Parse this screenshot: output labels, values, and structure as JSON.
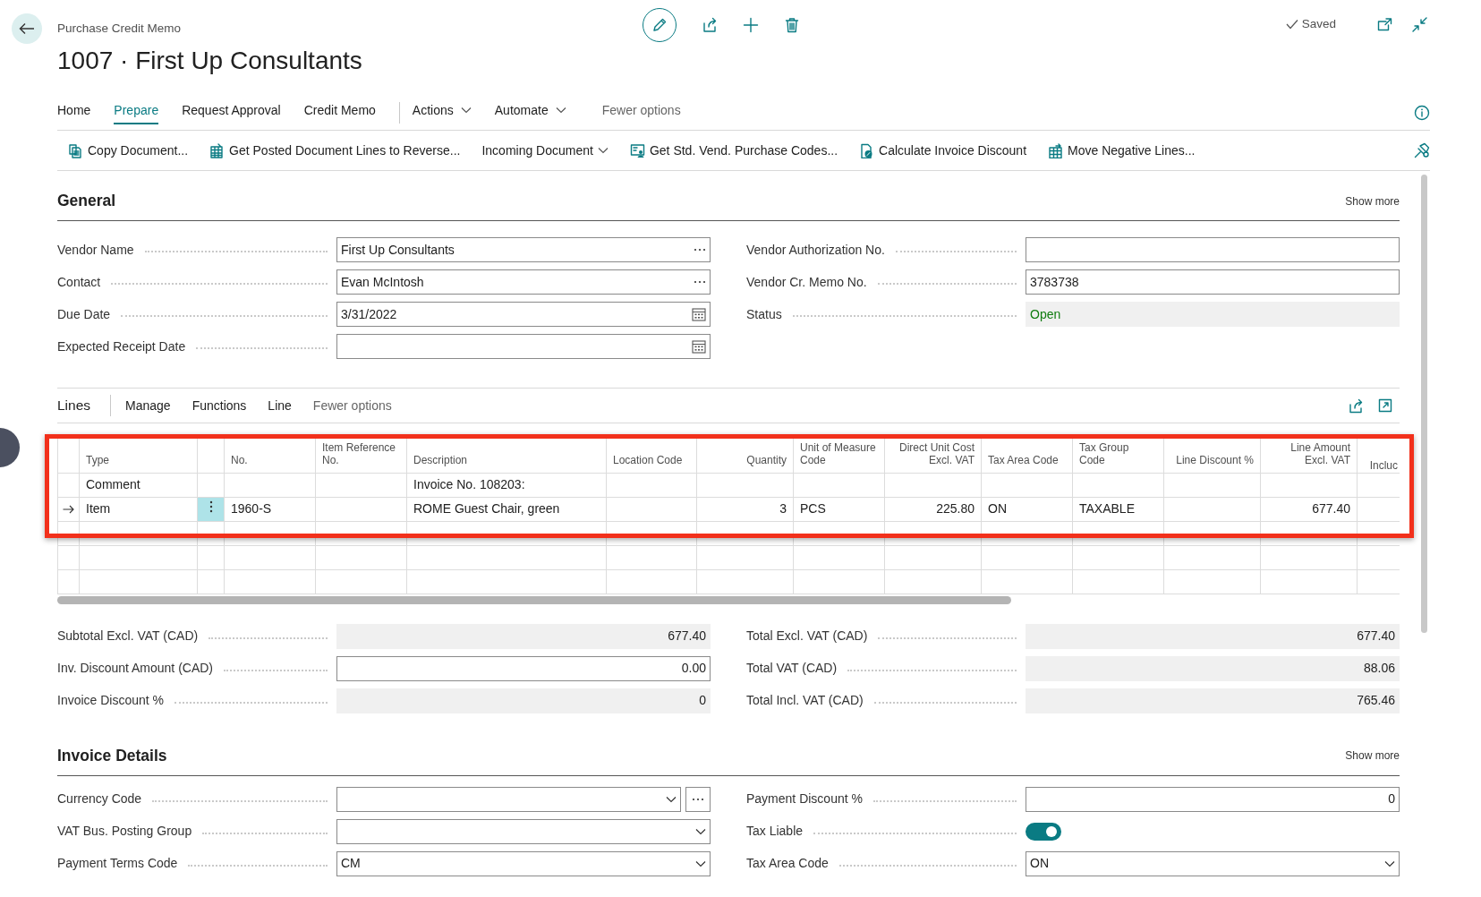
{
  "header": {
    "breadcrumb": "Purchase Credit Memo",
    "title": "1007 · First Up Consultants",
    "saved": "Saved"
  },
  "tabs": [
    {
      "label": "Home",
      "selected": false,
      "kind": "tab"
    },
    {
      "label": "Prepare",
      "selected": true,
      "kind": "tab"
    },
    {
      "label": "Request Approval",
      "selected": false,
      "kind": "tab"
    },
    {
      "label": "Credit Memo",
      "selected": false,
      "kind": "tab"
    },
    {
      "label": "Actions",
      "selected": false,
      "kind": "menu"
    },
    {
      "label": "Automate",
      "selected": false,
      "kind": "menu"
    },
    {
      "label": "Fewer options",
      "selected": false,
      "kind": "more"
    }
  ],
  "actions": [
    {
      "label": "Copy Document...",
      "dropdown": false
    },
    {
      "label": "Get Posted Document Lines to Reverse...",
      "dropdown": false
    },
    {
      "label": "Incoming Document",
      "dropdown": true
    },
    {
      "label": "Get Std. Vend. Purchase Codes...",
      "dropdown": false
    },
    {
      "label": "Calculate Invoice Discount",
      "dropdown": false
    },
    {
      "label": "Move Negative Lines...",
      "dropdown": false
    }
  ],
  "general": {
    "title": "General",
    "show_more": "Show more",
    "left": [
      {
        "label": "Vendor Name",
        "value": "First Up Consultants",
        "kind": "lookup"
      },
      {
        "label": "Contact",
        "value": "Evan McIntosh",
        "kind": "lookup"
      },
      {
        "label": "Due Date",
        "value": "3/31/2022",
        "kind": "date"
      },
      {
        "label": "Expected Receipt Date",
        "kind": "date"
      }
    ],
    "right": [
      {
        "label": "Vendor Authorization No.",
        "kind": "text"
      },
      {
        "label": "Vendor Cr. Memo No.",
        "value": "3783738",
        "kind": "text"
      },
      {
        "label": "Status",
        "value": "Open",
        "kind": "status"
      }
    ]
  },
  "lines": {
    "title": "Lines",
    "menu": [
      "Manage",
      "Functions",
      "Line",
      "Fewer options"
    ],
    "columns": [
      "Type",
      "No.",
      "Item Reference No.",
      "Description",
      "Location Code",
      "Quantity",
      "Unit of Measure Code",
      "Direct Unit Cost Excl. VAT",
      "Tax Area Code",
      "Tax Group Code",
      "Line Discount %",
      "Line Amount Excl. VAT",
      "Incluc"
    ],
    "rows": [
      {
        "selected": false,
        "cells": [
          "Comment",
          null,
          null,
          "Invoice No. 108203:",
          null,
          null,
          null,
          null,
          null,
          null,
          null,
          null,
          null
        ]
      },
      {
        "selected": true,
        "cells": [
          "Item",
          "1960-S",
          null,
          "ROME Guest Chair, green",
          null,
          "3",
          "PCS",
          "225.80",
          "ON",
          "TAXABLE",
          null,
          "677.40",
          null
        ]
      }
    ]
  },
  "totals": {
    "left": [
      {
        "label": "Subtotal Excl. VAT (CAD)",
        "value": "677.40",
        "kind": "readonly"
      },
      {
        "label": "Inv. Discount Amount (CAD)",
        "value": "0.00",
        "kind": "number"
      },
      {
        "label": "Invoice Discount %",
        "value": "0",
        "kind": "readonly"
      }
    ],
    "right": [
      {
        "label": "Total Excl. VAT (CAD)",
        "value": "677.40",
        "kind": "readonly"
      },
      {
        "label": "Total VAT (CAD)",
        "value": "88.06",
        "kind": "readonly"
      },
      {
        "label": "Total Incl. VAT (CAD)",
        "value": "765.46",
        "kind": "readonly"
      }
    ]
  },
  "invoice_details": {
    "title": "Invoice Details",
    "show_more": "Show more",
    "left": [
      {
        "label": "Currency Code",
        "kind": "dropdown_lookup"
      },
      {
        "label": "VAT Bus. Posting Group",
        "kind": "dropdown"
      },
      {
        "label": "Payment Terms Code",
        "value": "CM",
        "kind": "dropdown"
      }
    ],
    "right": [
      {
        "label": "Payment Discount %",
        "value": "0",
        "kind": "number"
      },
      {
        "label": "Tax Liable",
        "kind": "toggle",
        "on": true
      },
      {
        "label": "Tax Area Code",
        "value": "ON",
        "kind": "dropdown"
      }
    ]
  }
}
